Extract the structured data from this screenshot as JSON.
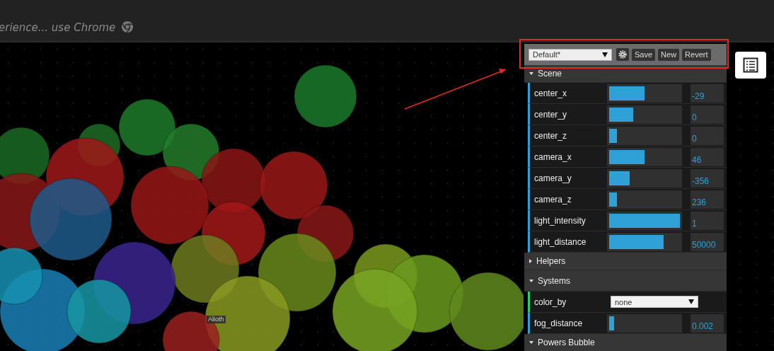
{
  "top_bar": {
    "notice": "erience... use Chrome"
  },
  "scene": {
    "star_label": "Alioth"
  },
  "controls_panel": {
    "preset": "Default*",
    "buttons": [
      "Save",
      "New",
      "Revert"
    ],
    "folders": [
      {
        "title": "Scene",
        "expanded": true,
        "controls": [
          {
            "kind": "slider",
            "label": "center_x",
            "level": 0.5,
            "value": "-29"
          },
          {
            "kind": "slider",
            "label": "center_y",
            "level": 0.34,
            "value": "0"
          },
          {
            "kind": "slider",
            "label": "center_z",
            "level": 0.11,
            "value": "0"
          },
          {
            "kind": "slider",
            "label": "camera_x",
            "level": 0.5,
            "value": "46"
          },
          {
            "kind": "slider",
            "label": "camera_y",
            "level": 0.29,
            "value": "-356"
          },
          {
            "kind": "slider",
            "label": "camera_z",
            "level": 0.11,
            "value": "236"
          },
          {
            "kind": "slider",
            "label": "light_intensity",
            "level": 1,
            "value": "1"
          },
          {
            "kind": "slider",
            "label": "light_distance",
            "level": 0.77,
            "value": "50000"
          }
        ]
      },
      {
        "title": "Helpers",
        "expanded": false
      },
      {
        "title": "Systems",
        "expanded": true,
        "controls": [
          {
            "kind": "select",
            "label": "color_by",
            "value": "none"
          },
          {
            "kind": "slider",
            "label": "fog_distance",
            "level": 0.07,
            "value": "0.002"
          }
        ]
      },
      {
        "title": "Powers Bubble",
        "expanded": true
      }
    ]
  }
}
